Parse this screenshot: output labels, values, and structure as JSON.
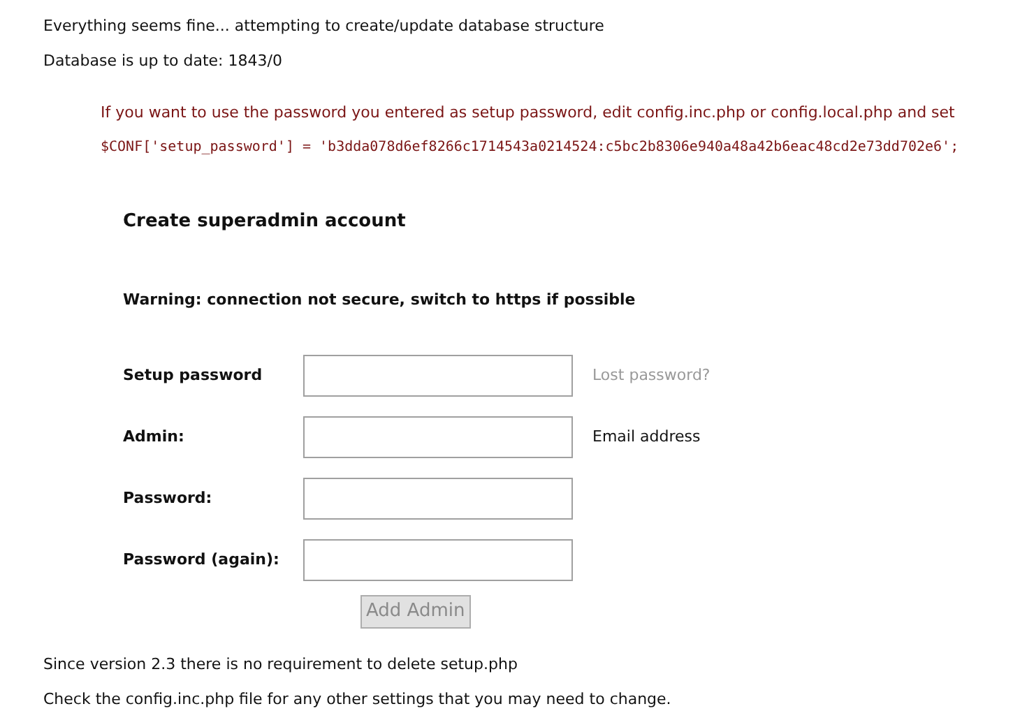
{
  "messages": [
    "Everything seems fine... attempting to create/update database structure",
    "Database is up to date: 1843/0"
  ],
  "setup_note": {
    "text": "If you want to use the password you entered as setup password, edit config.inc.php or config.local.php and set",
    "code": "$CONF['setup_password'] = 'b3dda078d6ef8266c1714543a0214524:c5bc2b8306e940a48a42b6eac48cd2e73dd702e6';"
  },
  "form": {
    "title": "Create superadmin account",
    "warning": "Warning: connection not secure, switch to https if possible",
    "fields": [
      {
        "label": "Setup password",
        "hint": "Lost password?",
        "kind": "link"
      },
      {
        "label": "Admin:",
        "hint": "Email address",
        "kind": "text"
      },
      {
        "label": "Password:"
      },
      {
        "label": "Password (again):"
      }
    ],
    "button": {
      "label": "Add Admin",
      "disabled": true
    }
  },
  "footer": [
    "Since version 2.3 there is no requirement to delete setup.php",
    "Check the config.inc.php file for any other settings that you may need to change."
  ]
}
